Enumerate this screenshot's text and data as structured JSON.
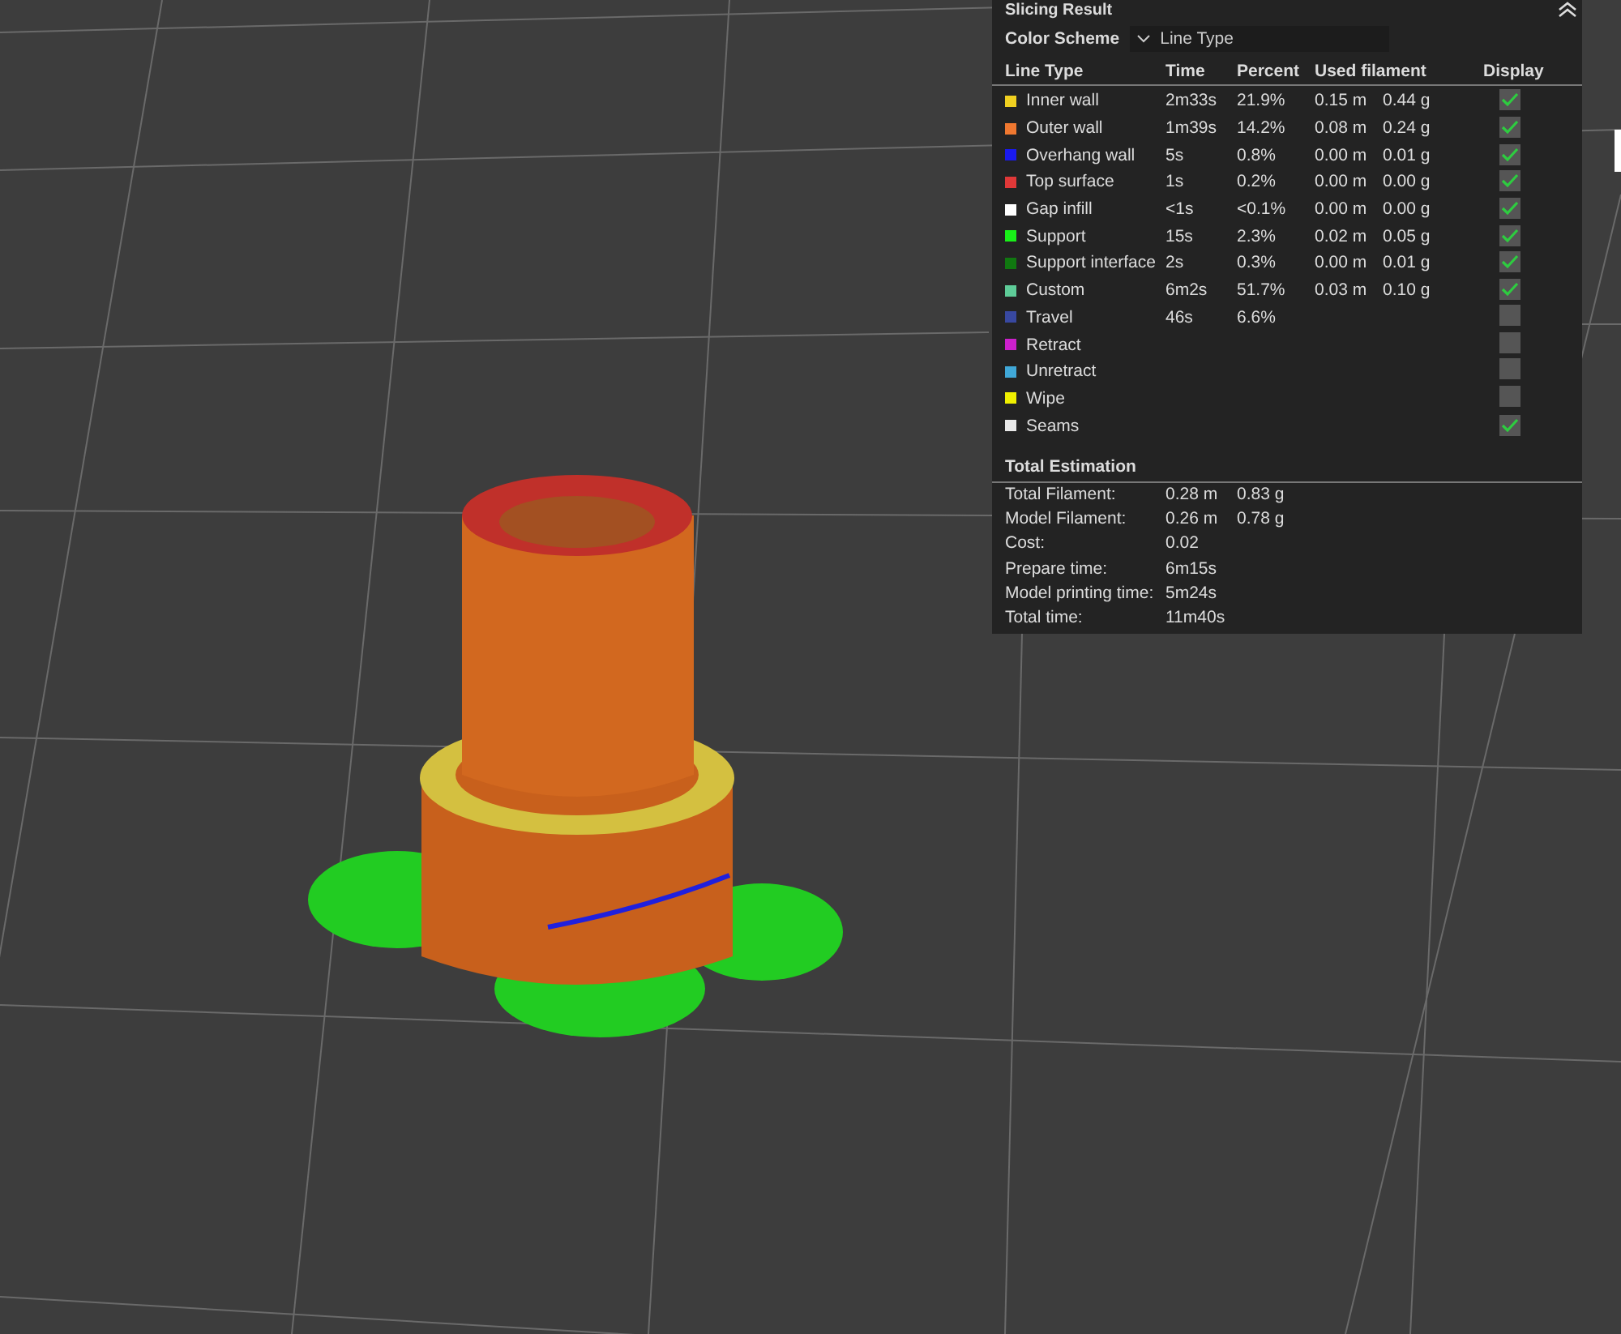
{
  "panel": {
    "title": "Slicing Result",
    "color_scheme": {
      "label": "Color Scheme",
      "value": "Line Type"
    },
    "columns": [
      "Line Type",
      "Time",
      "Percent",
      "Used filament",
      "Display"
    ],
    "rows": [
      {
        "name": "Inner wall",
        "color": "#f0d020",
        "time": "2m33s",
        "percent": "21.9%",
        "length": "0.15 m",
        "weight": "0.44 g",
        "checked": true
      },
      {
        "name": "Outer wall",
        "color": "#f07830",
        "time": "1m39s",
        "percent": "14.2%",
        "length": "0.08 m",
        "weight": "0.24 g",
        "checked": true
      },
      {
        "name": "Overhang wall",
        "color": "#1a1aee",
        "time": "5s",
        "percent": "0.8%",
        "length": "0.00 m",
        "weight": "0.01 g",
        "checked": true
      },
      {
        "name": "Top surface",
        "color": "#e03838",
        "time": "1s",
        "percent": "0.2%",
        "length": "0.00 m",
        "weight": "0.00 g",
        "checked": true
      },
      {
        "name": "Gap infill",
        "color": "#ffffff",
        "time": "<1s",
        "percent": "<0.1%",
        "length": "0.00 m",
        "weight": "0.00 g",
        "checked": true
      },
      {
        "name": "Support",
        "color": "#18f018",
        "time": "15s",
        "percent": "2.3%",
        "length": "0.02 m",
        "weight": "0.05 g",
        "checked": true
      },
      {
        "name": "Support interface",
        "color": "#107810",
        "time": "2s",
        "percent": "0.3%",
        "length": "0.00 m",
        "weight": "0.01 g",
        "checked": true
      },
      {
        "name": "Custom",
        "color": "#5ecc98",
        "time": "6m2s",
        "percent": "51.7%",
        "length": "0.03 m",
        "weight": "0.10 g",
        "checked": true
      },
      {
        "name": "Travel",
        "color": "#3848a0",
        "time": "46s",
        "percent": "6.6%",
        "checked": false
      },
      {
        "name": "Retract",
        "color": "#cc20cc",
        "checked": false
      },
      {
        "name": "Unretract",
        "color": "#40a8d8",
        "checked": false
      },
      {
        "name": "Wipe",
        "color": "#f0f000",
        "checked": false
      },
      {
        "name": "Seams",
        "color": "#e8e8e8",
        "checked": true
      }
    ],
    "total": {
      "title": "Total Estimation",
      "rows": [
        {
          "label": "Total Filament:",
          "value": "0.28 m",
          "value_2": "0.83 g"
        },
        {
          "label": "Model Filament:",
          "value": "0.26 m",
          "value_2": "0.78 g"
        },
        {
          "label": "Cost:",
          "value": "0.02"
        },
        {
          "label": "Prepare time:",
          "value": "6m15s"
        },
        {
          "label": "Model printing time:",
          "value": "5m24s"
        },
        {
          "label": "Total time:",
          "value": "11m40s"
        }
      ]
    }
  }
}
